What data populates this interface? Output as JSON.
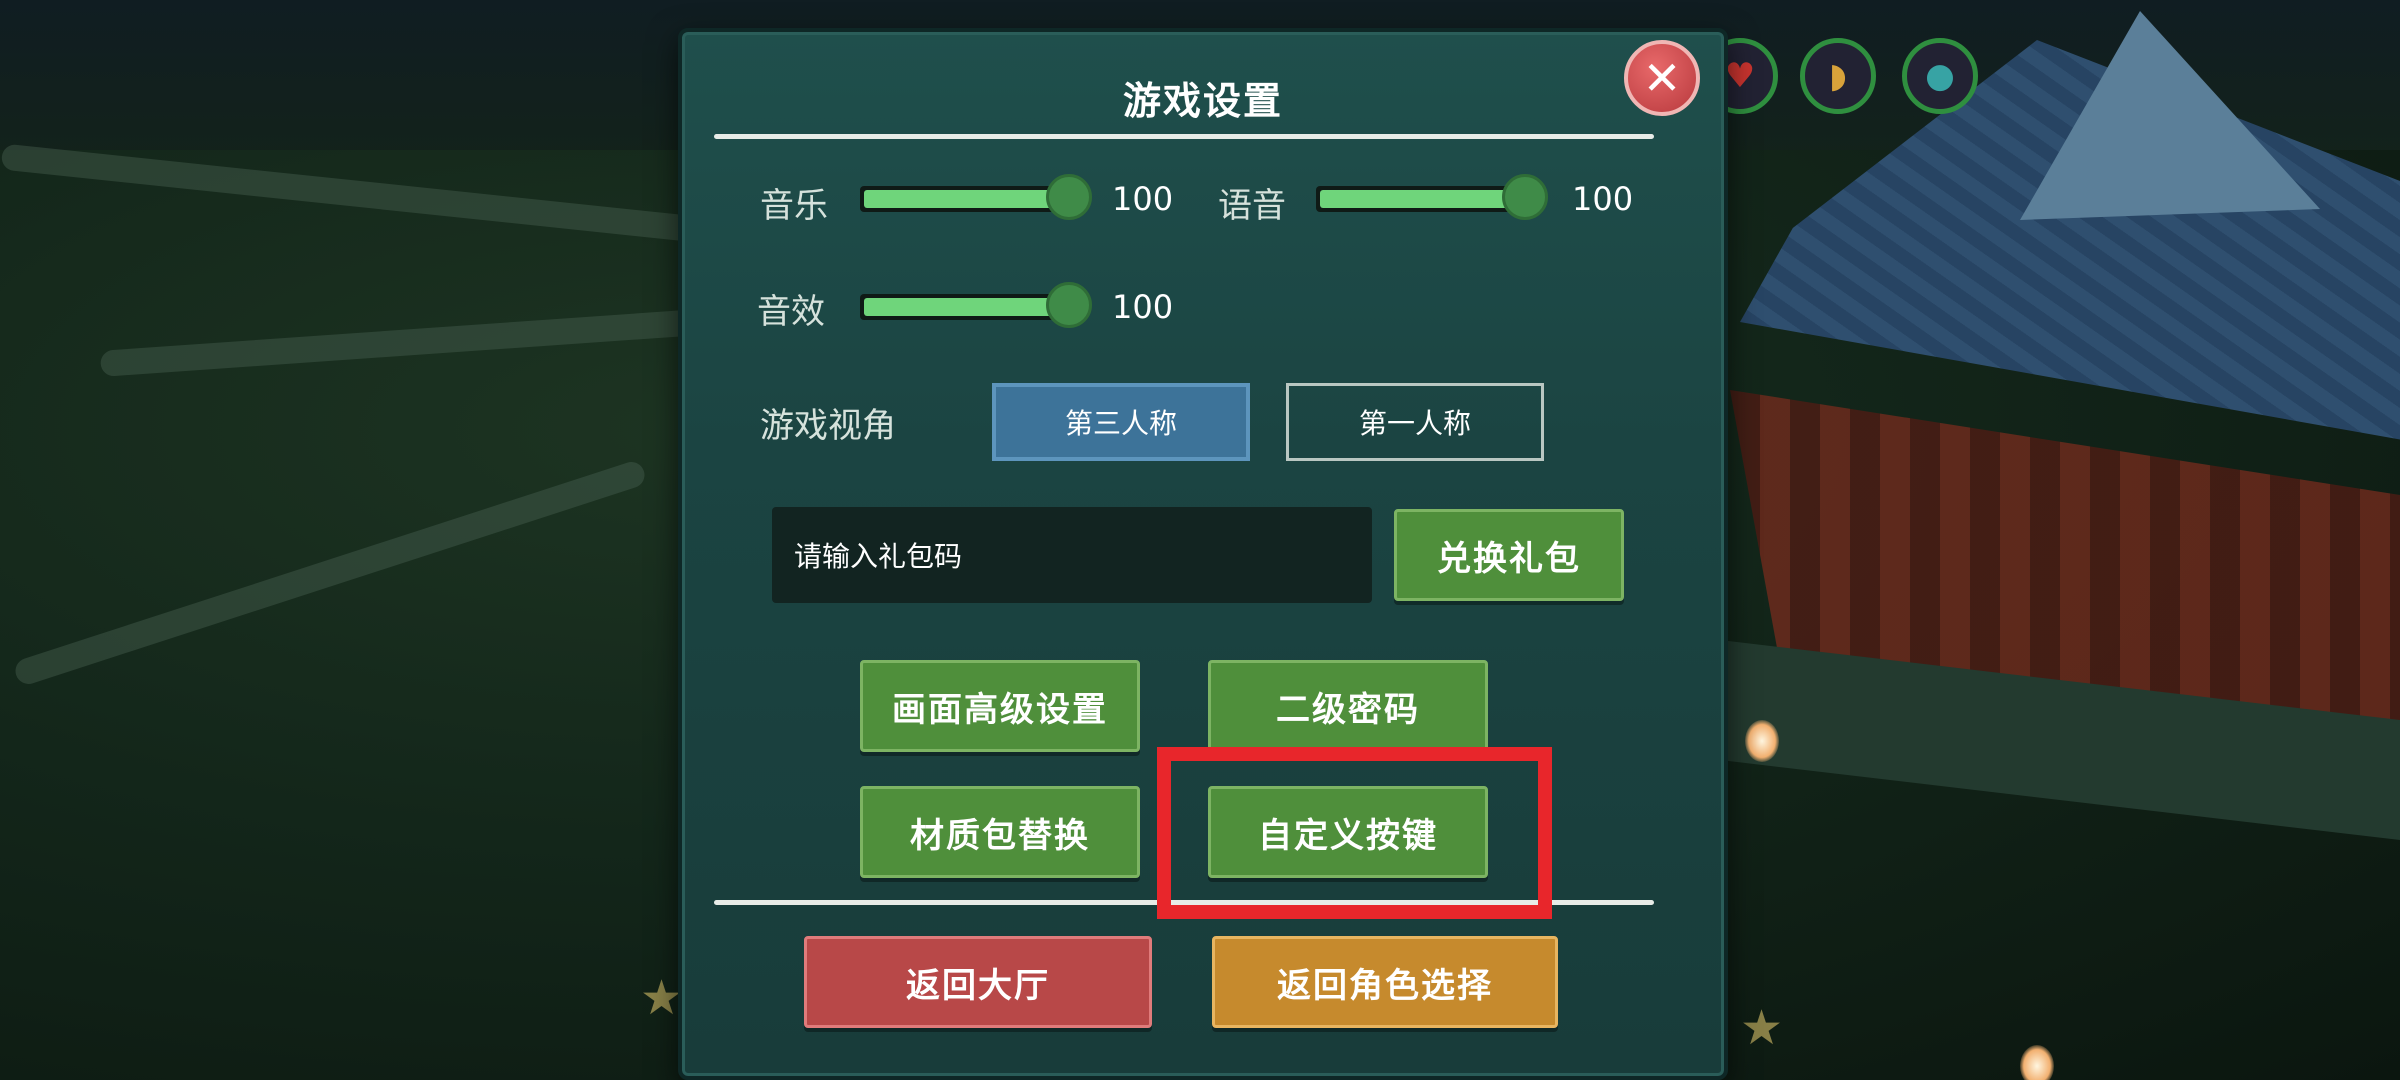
{
  "dialog": {
    "title": "游戏设置",
    "close_icon": "close-x-icon"
  },
  "audio": {
    "music": {
      "label": "音乐",
      "value": "100",
      "level": 1.0
    },
    "voice": {
      "label": "语音",
      "value": "100",
      "level": 1.0
    },
    "sfx": {
      "label": "音效",
      "value": "100",
      "level": 1.0
    }
  },
  "view": {
    "label": "游戏视角",
    "options": [
      {
        "label": "第三人称",
        "selected": true
      },
      {
        "label": "第一人称",
        "selected": false
      }
    ]
  },
  "gift": {
    "placeholder": "请输入礼包码",
    "redeem_label": "兑换礼包"
  },
  "actions": {
    "graphics": "画面高级设置",
    "second_password": "二级密码",
    "texture_pack": "材质包替换",
    "custom_keys": "自定义按键"
  },
  "footer": {
    "back_lobby": "返回大厅",
    "back_character": "返回角色选择"
  },
  "colors": {
    "accent_green": "#4f8f3b",
    "slider_fill": "#6fd57b",
    "selected_tab": "#3d7399",
    "danger": "#b84848",
    "warning": "#c68a2d",
    "highlight": "#e8262b"
  },
  "hud_icons": [
    "heart-icon",
    "food-icon",
    "water-drop-icon"
  ]
}
